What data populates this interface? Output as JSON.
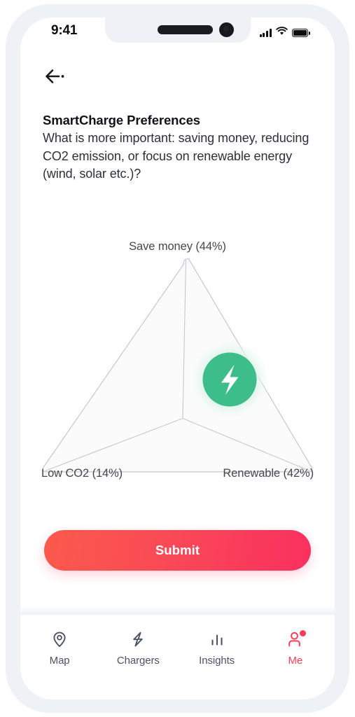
{
  "status_bar": {
    "time": "9:41",
    "icons": [
      "signal-icon",
      "wifi-icon",
      "battery-icon"
    ]
  },
  "nav": {
    "back_icon": "back-arrow-icon"
  },
  "content": {
    "title": "SmartCharge Preferences",
    "question": "What is more important: saving money, reducing CO2 emission, or focus on renewable energy (wind, solar etc.)?"
  },
  "chart_data": {
    "type": "pie",
    "subtype": "ternary-preference-selector",
    "title": "SmartCharge Preferences",
    "categories": [
      "Save money",
      "Low CO2",
      "Renewable"
    ],
    "values": [
      44,
      14,
      42
    ],
    "labels": [
      "Save money (44%)",
      "Low CO2 (14%)",
      "Renewable (42%)"
    ],
    "unit": "%",
    "legend": "none",
    "grid": false,
    "handle_icon": "lightning-bolt-icon",
    "colors": {
      "handle": "#3cbd8a",
      "handle_halo": "#dff3e9",
      "outline": "#c9cbd1",
      "fill": "#fafafb"
    }
  },
  "submit": {
    "label": "Submit",
    "gradient_start": "#fb5a4c",
    "gradient_end": "#f9305f"
  },
  "bottom_nav": {
    "active_color": "#fb3e55",
    "inactive_color": "#4c5266",
    "items": [
      {
        "label": "Map",
        "icon": "map-pin-icon",
        "active": false,
        "badge": false
      },
      {
        "label": "Chargers",
        "icon": "lightning-bolt-icon",
        "active": false,
        "badge": false
      },
      {
        "label": "Insights",
        "icon": "bar-chart-icon",
        "active": false,
        "badge": false
      },
      {
        "label": "Me",
        "icon": "person-icon",
        "active": true,
        "badge": true
      }
    ]
  }
}
